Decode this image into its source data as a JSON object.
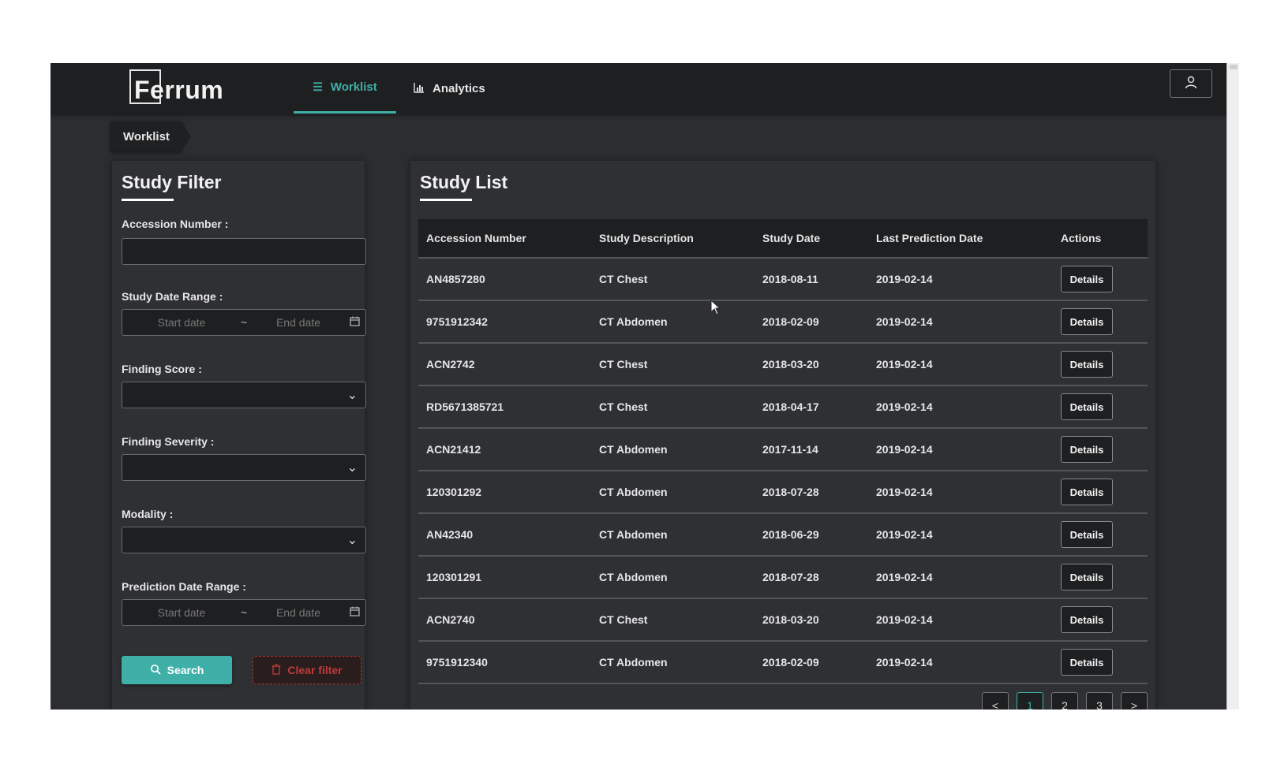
{
  "header": {
    "logo": "Ferrum",
    "tabs": [
      {
        "label": "Worklist",
        "icon": "list-icon",
        "active": true
      },
      {
        "label": "Analytics",
        "icon": "bar-chart-icon",
        "active": false
      }
    ],
    "user_icon": "user-icon"
  },
  "breadcrumb": "Worklist",
  "filter": {
    "title": "Study Filter",
    "accession_label": "Accession Number :",
    "accession_value": "",
    "study_date_label": "Study Date Range :",
    "study_start_placeholder": "Start date",
    "study_end_placeholder": "End date",
    "finding_score_label": "Finding Score :",
    "finding_severity_label": "Finding Severity :",
    "modality_label": "Modality :",
    "prediction_date_label": "Prediction Date Range :",
    "prediction_start_placeholder": "Start date",
    "prediction_end_placeholder": "End date",
    "range_separator": "~",
    "search_label": "Search",
    "clear_label": "Clear filter"
  },
  "study_list": {
    "title": "Study List",
    "columns": [
      "Accession Number",
      "Study Description",
      "Study Date",
      "Last Prediction Date",
      "Actions"
    ],
    "rows": [
      {
        "accession": "AN4857280",
        "description": "CT Chest",
        "study_date": "2018-08-11",
        "prediction_date": "2019-02-14",
        "action": "Details"
      },
      {
        "accession": "9751912342",
        "description": "CT Abdomen",
        "study_date": "2018-02-09",
        "prediction_date": "2019-02-14",
        "action": "Details"
      },
      {
        "accession": "ACN2742",
        "description": "CT Chest",
        "study_date": "2018-03-20",
        "prediction_date": "2019-02-14",
        "action": "Details"
      },
      {
        "accession": "RD5671385721",
        "description": "CT Chest",
        "study_date": "2018-04-17",
        "prediction_date": "2019-02-14",
        "action": "Details"
      },
      {
        "accession": "ACN21412",
        "description": "CT Abdomen",
        "study_date": "2017-11-14",
        "prediction_date": "2019-02-14",
        "action": "Details"
      },
      {
        "accession": "120301292",
        "description": "CT Abdomen",
        "study_date": "2018-07-28",
        "prediction_date": "2019-02-14",
        "action": "Details"
      },
      {
        "accession": "AN42340",
        "description": "CT Abdomen",
        "study_date": "2018-06-29",
        "prediction_date": "2019-02-14",
        "action": "Details"
      },
      {
        "accession": "120301291",
        "description": "CT Abdomen",
        "study_date": "2018-07-28",
        "prediction_date": "2019-02-14",
        "action": "Details"
      },
      {
        "accession": "ACN2740",
        "description": "CT Chest",
        "study_date": "2018-03-20",
        "prediction_date": "2019-02-14",
        "action": "Details"
      },
      {
        "accession": "9751912340",
        "description": "CT Abdomen",
        "study_date": "2018-02-09",
        "prediction_date": "2019-02-14",
        "action": "Details"
      }
    ],
    "pagination": {
      "prev": "<",
      "pages": [
        "1",
        "2",
        "3"
      ],
      "current": "1",
      "next": ">"
    }
  },
  "colors": {
    "accent": "#3fb0a8",
    "danger": "#c23a3a",
    "background": "#2b2d30",
    "topbar": "#1e1f21"
  }
}
